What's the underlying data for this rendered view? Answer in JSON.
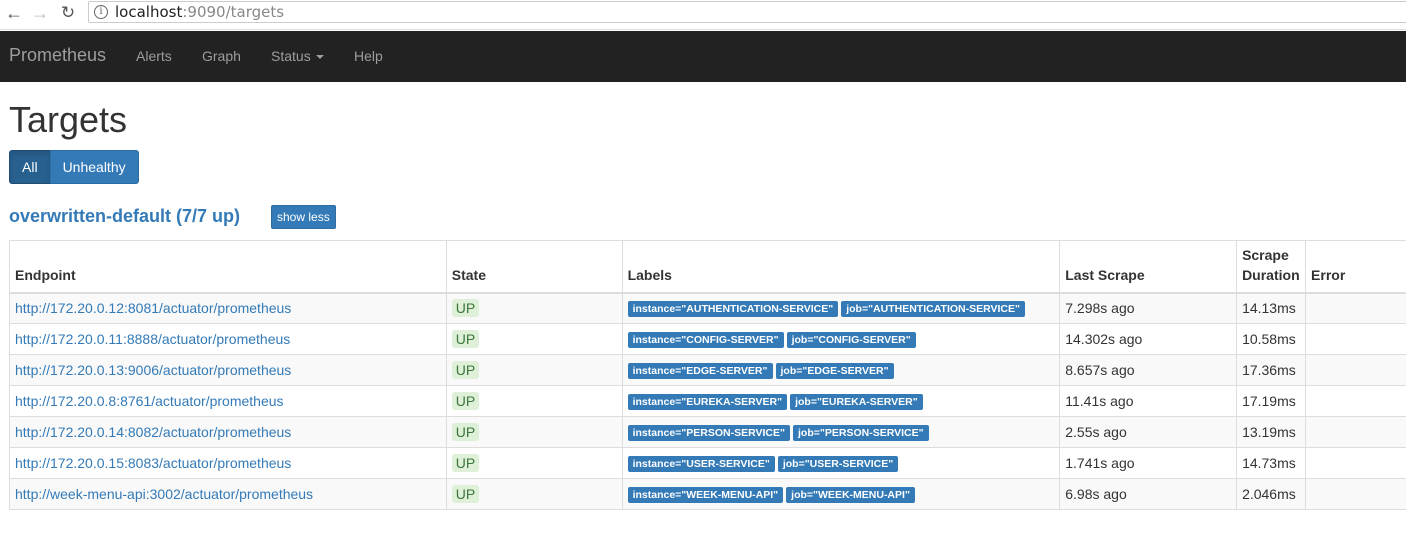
{
  "browser": {
    "url_host": "localhost",
    "url_rest": ":9090/targets"
  },
  "navbar": {
    "brand": "Prometheus",
    "items": [
      "Alerts",
      "Graph",
      "Status",
      "Help"
    ]
  },
  "page": {
    "title": "Targets",
    "filters": {
      "all": "All",
      "unhealthy": "Unhealthy"
    }
  },
  "job": {
    "title": "overwritten-default (7/7 up)",
    "toggle_label": "show less"
  },
  "table": {
    "headers": {
      "endpoint": "Endpoint",
      "state": "State",
      "labels": "Labels",
      "last_scrape": "Last Scrape",
      "scrape_duration": "Scrape Duration",
      "error": "Error"
    },
    "rows": [
      {
        "endpoint": "http://172.20.0.12:8081/actuator/prometheus",
        "state": "UP",
        "instance": "instance=\"AUTHENTICATION-SERVICE\"",
        "job": "job=\"AUTHENTICATION-SERVICE\"",
        "last_scrape": "7.298s ago",
        "duration": "14.13ms",
        "error": ""
      },
      {
        "endpoint": "http://172.20.0.11:8888/actuator/prometheus",
        "state": "UP",
        "instance": "instance=\"CONFIG-SERVER\"",
        "job": "job=\"CONFIG-SERVER\"",
        "last_scrape": "14.302s ago",
        "duration": "10.58ms",
        "error": ""
      },
      {
        "endpoint": "http://172.20.0.13:9006/actuator/prometheus",
        "state": "UP",
        "instance": "instance=\"EDGE-SERVER\"",
        "job": "job=\"EDGE-SERVER\"",
        "last_scrape": "8.657s ago",
        "duration": "17.36ms",
        "error": ""
      },
      {
        "endpoint": "http://172.20.0.8:8761/actuator/prometheus",
        "state": "UP",
        "instance": "instance=\"EUREKA-SERVER\"",
        "job": "job=\"EUREKA-SERVER\"",
        "last_scrape": "11.41s ago",
        "duration": "17.19ms",
        "error": ""
      },
      {
        "endpoint": "http://172.20.0.14:8082/actuator/prometheus",
        "state": "UP",
        "instance": "instance=\"PERSON-SERVICE\"",
        "job": "job=\"PERSON-SERVICE\"",
        "last_scrape": "2.55s ago",
        "duration": "13.19ms",
        "error": ""
      },
      {
        "endpoint": "http://172.20.0.15:8083/actuator/prometheus",
        "state": "UP",
        "instance": "instance=\"USER-SERVICE\"",
        "job": "job=\"USER-SERVICE\"",
        "last_scrape": "1.741s ago",
        "duration": "14.73ms",
        "error": ""
      },
      {
        "endpoint": "http://week-menu-api:3002/actuator/prometheus",
        "state": "UP",
        "instance": "instance=\"WEEK-MENU-API\"",
        "job": "job=\"WEEK-MENU-API\"",
        "last_scrape": "6.98s ago",
        "duration": "2.046ms",
        "error": ""
      }
    ]
  }
}
